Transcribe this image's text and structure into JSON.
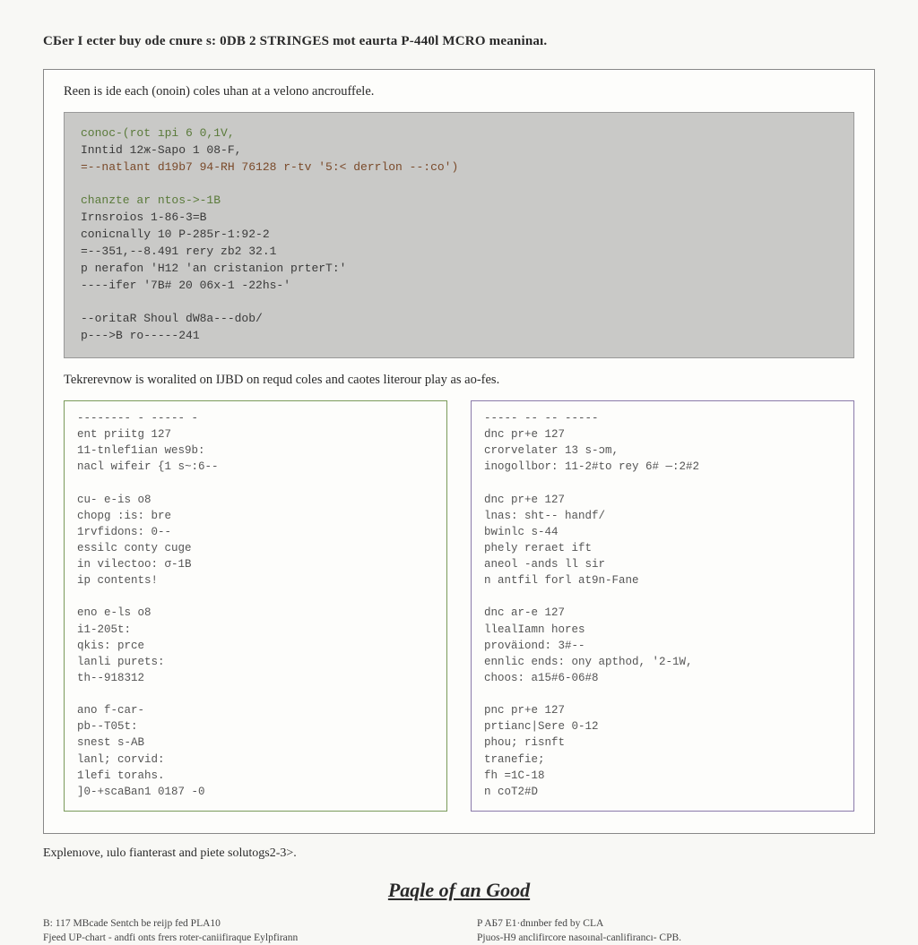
{
  "headline": "CБer I ecter buy ode cnure s: 0DB 2 STRINGES mot eaurta P-440l MCRO meaninaı.",
  "box": {
    "intro": "Reen is ide each (onoin) coles uhan at a velono ancrouffele.",
    "code_lines": [
      "conoc-(rot ıpi 6 0,1V,",
      "Inntid 12ж-Sapo 1 08-F,",
      "=--natlant d19b7 94-RH 76128 r-tv '5:< derrlon --:co')",
      "",
      "chanzte ar ntos->-1B",
      "Irnsroios 1-86-3=B",
      "conicnally 10 P-285r-1:92-2",
      "=--351,--8.491 rery zb2 32.1",
      "p nerafon 'H12 'an cristanion prterT:'",
      "----ifer '7B# 20 06x-1 -22hs-'",
      "",
      "--oritaR Shoul dW8a---dob/",
      "p--->B ro-----241"
    ],
    "mid": "Tekrerevnow is woralited on IJBD on requd coles and caotes literour play as ao-fes.",
    "left_lines": [
      "-------- - ----- -",
      "ent priitg 127",
      "11-tnlef1ian wes9b:",
      "nacl wifeir {1 s~:6--",
      "",
      "cu- e-is o8",
      "chopg :is: bre",
      "1rvfidons: 0--",
      "essilc conty cuge",
      "in vilectoo: σ-1B",
      "ip contents!",
      "",
      "eno e-ls o8",
      "i1-205t:",
      "qkis: prce",
      "lanli purets:",
      "th--918312",
      "",
      "ano f-car-",
      "pb--T05t:",
      "snest s-AB",
      "lanl; corvid:",
      "1lefi torahs.",
      "]0-+scaBan1 0187 -0"
    ],
    "right_lines": [
      "----- -- -- -----",
      "dnc pr+e 127",
      "crorvelater 13 s-ɔm,",
      "inogollbor: 11-2#to rey 6# —:2#2",
      "",
      "dnc pr+e 127",
      "lnas: sht-- handf/",
      "bwinlc s-44",
      "phely reraet ift",
      "aneol -ands ll sir",
      "n antfil forl at9n-Fane",
      "",
      "dnc ar-e 127",
      "llealIamn hores",
      "proväiond: 3#--",
      "ennlic ends: ony apthod, '2-1W,",
      "choos: a15#6-06#8",
      "",
      "pnc pr+e 127",
      "prtianc|Sere 0-12",
      "phou; risnft",
      "tranefie;",
      "fh =1C-18",
      "n coT2#D"
    ]
  },
  "explain": "Explenıove, ıulo fianterast and piete solutogs2-3>.",
  "footer_title": "Paqle of an Good",
  "foot_left_1": "B: 117 MBcade Sentch be reijp fed PLA10",
  "foot_left_2": "Fjeed UP-chart - andfi onts frers roter-caniifiraque Eylpfirann",
  "foot_right_1": "P AБ7 E1·dnınber fed by CLA",
  "foot_right_2": "Pjuos-H9 anclifircore nasoınal-canlifirancı- CPB."
}
